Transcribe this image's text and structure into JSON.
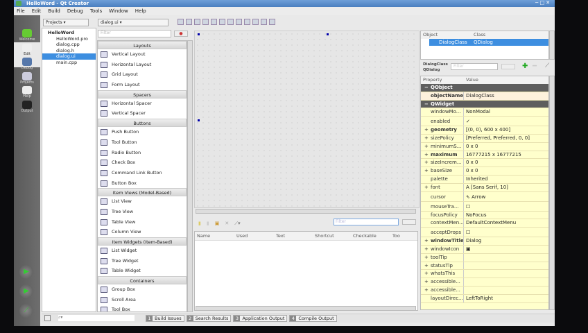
{
  "window": {
    "title": "HelloWord - Qt Creator"
  },
  "menu": [
    "File",
    "Edit",
    "Build",
    "Debug",
    "Tools",
    "Window",
    "Help"
  ],
  "modes": [
    {
      "label": "Welcome",
      "icon": "qt-logo-icon"
    },
    {
      "label": "Edit",
      "icon": "edit-icon"
    },
    {
      "label": "Debug",
      "icon": "debug-icon"
    },
    {
      "label": "Projects",
      "icon": "projects-icon"
    },
    {
      "label": "Help",
      "icon": "help-book-icon"
    },
    {
      "label": "Output",
      "icon": "output-icon"
    }
  ],
  "projects": {
    "combo": "Projects",
    "tree": [
      {
        "label": "HelloWord",
        "root": true
      },
      {
        "label": "HelloWord.pro"
      },
      {
        "label": "dialog.cpp"
      },
      {
        "label": "dialog.h"
      },
      {
        "label": "dialog.ui",
        "selected": true
      },
      {
        "label": "main.cpp"
      }
    ]
  },
  "editor": {
    "file_combo": "dialog.ui",
    "filter_placeholder": "Filter"
  },
  "widgetbox": [
    {
      "header": "Layouts",
      "items": [
        "Vertical Layout",
        "Horizontal Layout",
        "Grid Layout",
        "Form Layout"
      ]
    },
    {
      "header": "Spacers",
      "items": [
        "Horizontal Spacer",
        "Vertical Spacer"
      ]
    },
    {
      "header": "Buttons",
      "items": [
        "Push Button",
        "Tool Button",
        "Radio Button",
        "Check Box",
        "Command Link Button",
        "Button Box"
      ]
    },
    {
      "header": "Item Views (Model-Based)",
      "items": [
        "List View",
        "Tree View",
        "Table View",
        "Column View"
      ]
    },
    {
      "header": "Item Widgets (Item-Based)",
      "items": [
        "List Widget",
        "Tree Widget",
        "Table Widget"
      ]
    },
    {
      "header": "Containers",
      "items": [
        "Group Box",
        "Scroll Area",
        "Tool Box"
      ]
    }
  ],
  "action_editor": {
    "filter_placeholder": "Filter",
    "columns": [
      "Name",
      "Used",
      "Text",
      "Shortcut",
      "Checkable",
      "Too"
    ]
  },
  "object_inspector": {
    "columns": [
      "Object",
      "Class"
    ],
    "rows": [
      {
        "object": "DialogClass",
        "class": "QDialog"
      }
    ]
  },
  "property_editor": {
    "object": "DialogClass",
    "class": "QDialog",
    "filter_placeholder": "Filter",
    "columns": [
      "Property",
      "Value"
    ],
    "rows": [
      {
        "group": "QObject"
      },
      {
        "name": "objectName",
        "value": "DialogClass",
        "bold": true,
        "obj": true
      },
      {
        "group": "QWidget"
      },
      {
        "name": "windowMo...",
        "value": "NonModal"
      },
      {
        "name": "enabled",
        "value": "✓",
        "tall": true
      },
      {
        "name": "geometry",
        "value": "[(0, 0), 600 x 400]",
        "bold": true,
        "plus": true
      },
      {
        "name": "sizePolicy",
        "value": "[Preferred, Preferred, 0, 0]",
        "plus": true
      },
      {
        "name": "minimumS...",
        "value": "0 x 0",
        "plus": true
      },
      {
        "name": "maximum",
        "value": "16777215 x 16777215",
        "bold": true,
        "plus": true
      },
      {
        "name": "sizeIncrem...",
        "value": "0 x 0",
        "plus": true
      },
      {
        "name": "baseSize",
        "value": "0 x 0",
        "plus": true
      },
      {
        "name": "palette",
        "value": "Inherited"
      },
      {
        "name": "font",
        "value": "A  [Sans Serif, 10]",
        "plus": true
      },
      {
        "name": "cursor",
        "value": "⇖ Arrow",
        "tall": true
      },
      {
        "name": "mouseTra...",
        "value": "☐",
        "tall": true
      },
      {
        "name": "focusPolicy",
        "value": "NoFocus"
      },
      {
        "name": "contextMen...",
        "value": "DefaultContextMenu"
      },
      {
        "name": "acceptDrops",
        "value": "☐",
        "tall": true
      },
      {
        "name": "windowTitle",
        "value": "Dialog",
        "bold": true,
        "plus": true
      },
      {
        "name": "windowIcon",
        "value": "▣",
        "plus": true
      },
      {
        "name": "toolTip",
        "value": "",
        "plus": true
      },
      {
        "name": "statusTip",
        "value": "",
        "plus": true
      },
      {
        "name": "whatsThis",
        "value": "",
        "plus": true
      },
      {
        "name": "accessible...",
        "value": "",
        "plus": true
      },
      {
        "name": "accessible...",
        "value": "",
        "plus": true
      },
      {
        "name": "layoutDirec...",
        "value": "LeftToRight"
      }
    ]
  },
  "output_tabs": [
    {
      "num": "1",
      "label": "Build Issues"
    },
    {
      "num": "2",
      "label": "Search Results"
    },
    {
      "num": "3",
      "label": "Application Output"
    },
    {
      "num": "4",
      "label": "Compile Output"
    }
  ],
  "colors": {
    "title": "#4a7fc0",
    "selection": "#3d8ee0",
    "property_bg": "#ffffcc",
    "group_bg": "#5e5e5e"
  }
}
